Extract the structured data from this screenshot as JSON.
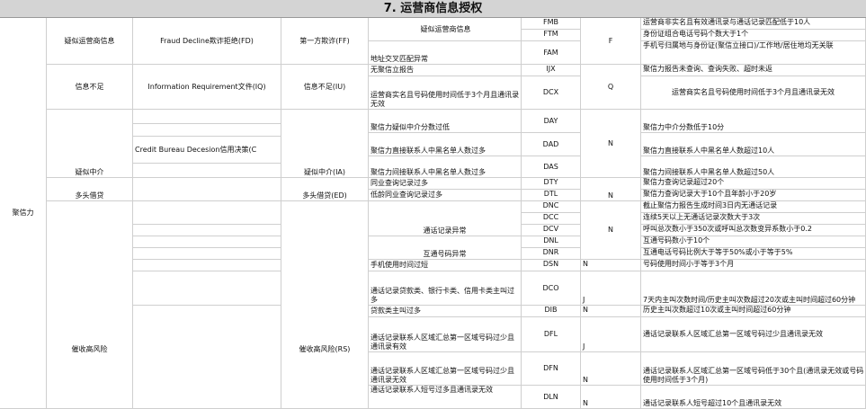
{
  "title": "7. 运营商信息授权",
  "col1": {
    "label": "聚信力"
  },
  "col2": {
    "r1": "疑似运营商信息",
    "r2": "信息不足",
    "r3": "疑似中介",
    "r4": "多头借贷",
    "r5": "催收高风险"
  },
  "col3": {
    "r1": "Fraud Decline欺诈拒绝(FD)",
    "r2": "Information Requirement文件(IQ)",
    "r3": "Credit Bureau Decesion信用决策(C"
  },
  "col4": {
    "r1": "第一方欺诈(FF)",
    "r2": "信息不足(IU)",
    "r3": "疑似中介(IA)",
    "r4": "多头借贷(ED)",
    "r5": "催收高风险(RS)"
  },
  "rows": [
    {
      "desc": "疑似运营商信息",
      "code": "FMB",
      "flag": "",
      "rule": "运营商非实名且有效通讯录与通话记录匹配低于10人"
    },
    {
      "desc": "",
      "code": "FTM",
      "flag": "",
      "rule": "身份证组合电话号码个数大于1个"
    },
    {
      "desc": "地址交叉匹配异常",
      "code": "FAM",
      "flag": "",
      "rule": "手机号归属地与身份证(聚信立接口)/工作地/居住地均无关联"
    },
    {
      "desc": "无聚信立报告",
      "code": "IJX",
      "flag": "",
      "rule": "聚信力报告未查询、查询失败、超时未返"
    },
    {
      "desc": "运营商实名且号码使用时间低于3个月且通讯录无效",
      "code": "DCX",
      "flag": "",
      "rule": "运营商实名且号码使用时间低于3个月且通讯录无效"
    },
    {
      "desc": "聚信力疑似中介分数过低",
      "code": "DAY",
      "flag": "",
      "rule": "聚信力中介分数低于10分"
    },
    {
      "desc": "聚信力直接联系人中黑名单人数过多",
      "code": "DAD",
      "flag": "",
      "rule": "聚信力直接联系人中黑名单人数超过10人"
    },
    {
      "desc": "聚信力间接联系人中黑名单人数过多",
      "code": "DAS",
      "flag": "",
      "rule": "聚信力间接联系人中黑名单人数超过50人"
    },
    {
      "desc": "同业查询记录过多",
      "code": "DTY",
      "flag": "",
      "rule": "聚信力查询记录超过20个"
    },
    {
      "desc": "低龄同业查询记录过多",
      "code": "DTL",
      "flag": "",
      "rule": "聚信力查询记录大于10个且年龄小于20岁"
    },
    {
      "desc": "",
      "code": "DNC",
      "flag": "",
      "rule": "截止聚信力报告生成时间3日内无通话记录"
    },
    {
      "desc": "",
      "code": "DCC",
      "flag": "",
      "rule": "连续5天以上无通话记录次数大于3次"
    },
    {
      "desc": "通话记录异常",
      "code": "DCV",
      "flag": "",
      "rule": "呼叫总次数小于350次或呼叫总次数变异系数小于0.2"
    },
    {
      "desc": "",
      "code": "DNL",
      "flag": "",
      "rule": "互通号码数小于10个"
    },
    {
      "desc": "互通号码异常",
      "code": "DNR",
      "flag": "",
      "rule": "互通电话号码比例大于等于50%或小于等于5%"
    },
    {
      "desc": "手机使用时间过短",
      "code": "DSN",
      "flag": "N",
      "rule": "号码使用时间小于等于3个月"
    },
    {
      "desc": "通话记录贷款类、银行卡类、信用卡类主叫过多",
      "code": "DCO",
      "flag": "J",
      "rule": "7天内主叫次数时间/历史主叫次数超过20次或主叫时间超过60分钟"
    },
    {
      "desc": "贷款类主叫过多",
      "code": "DIB",
      "flag": "N",
      "rule": "历史主叫次数超过10次或主叫时间超过60分钟"
    },
    {
      "desc": "通话记录联系人区域汇总第一区域号码过少且通讯录有效",
      "code": "DFL",
      "flag": "J",
      "rule": "通话记录联系人区域汇总第一区域号码过少且通讯录无效"
    },
    {
      "desc": "通话记录联系人区域汇总第一区域号码过少且通讯录无效",
      "code": "DFN",
      "flag": "N",
      "rule": "通话记录联系人区域汇总第一区域号码低于30个且(通讯录无效或号码使用时间低于3个月)"
    },
    {
      "desc": "通话记录联系人短号过多且通讯录无效",
      "code": "DLN",
      "flag": "N",
      "rule": "通话记录联系人短号超过10个且通讯录无效"
    }
  ],
  "groupFlags": {
    "g1": "F",
    "g2": "Q",
    "g3": "N",
    "g4": "N",
    "g5": "N"
  }
}
